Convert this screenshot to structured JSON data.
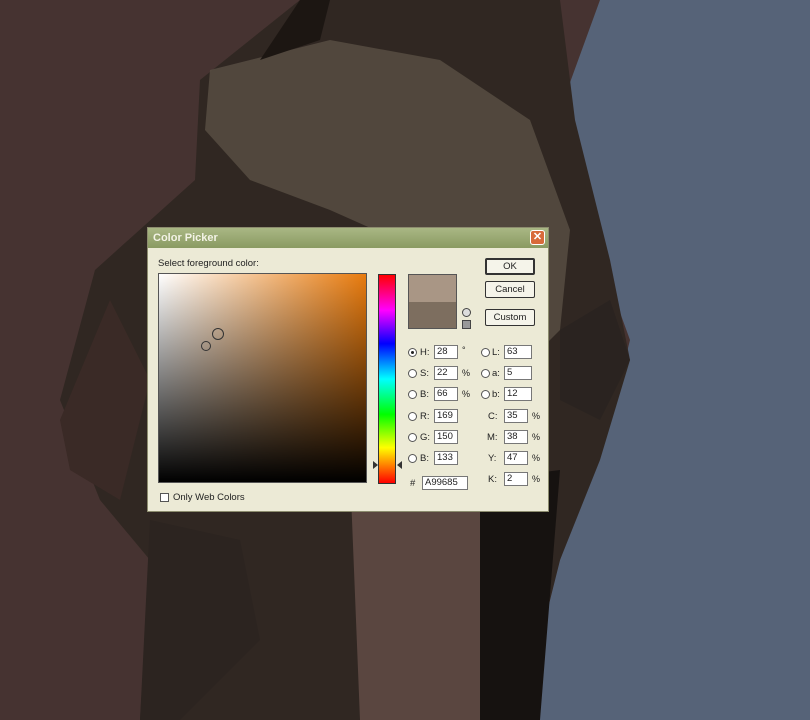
{
  "dialog": {
    "title": "Color Picker",
    "close_glyph": "✕",
    "prompt": "Select foreground color:",
    "ok_label": "OK",
    "cancel_label": "Cancel",
    "custom_label": "Custom",
    "only_web_colors_label": "Only Web Colors",
    "only_web_colors_checked": false
  },
  "colors": {
    "new_swatch": "#a99685",
    "current_swatch": "#7d6e5f",
    "field_hue": "#e87b0e"
  },
  "hsb": {
    "h": {
      "label": "H:",
      "value": "28",
      "unit": "°",
      "selected": true
    },
    "s": {
      "label": "S:",
      "value": "22",
      "unit": "%",
      "selected": false
    },
    "b": {
      "label": "B:",
      "value": "66",
      "unit": "%",
      "selected": false
    }
  },
  "rgb": {
    "r": {
      "label": "R:",
      "value": "169",
      "selected": false
    },
    "g": {
      "label": "G:",
      "value": "150",
      "selected": false
    },
    "b": {
      "label": "B:",
      "value": "133",
      "selected": false
    }
  },
  "lab": {
    "l": {
      "label": "L:",
      "value": "63",
      "selected": false
    },
    "a": {
      "label": "a:",
      "value": "5",
      "selected": false
    },
    "b": {
      "label": "b:",
      "value": "12",
      "selected": false
    }
  },
  "cmyk": {
    "c": {
      "label": "C:",
      "value": "35",
      "unit": "%"
    },
    "m": {
      "label": "M:",
      "value": "38",
      "unit": "%"
    },
    "y": {
      "label": "Y:",
      "value": "47",
      "unit": "%"
    },
    "k": {
      "label": "K:",
      "value": "2",
      "unit": "%"
    }
  },
  "hex": {
    "label": "#",
    "value": "A99685"
  },
  "icons": {
    "gamut_warning": "gamut-warning-icon",
    "web_safe": "web-safe-icon"
  }
}
